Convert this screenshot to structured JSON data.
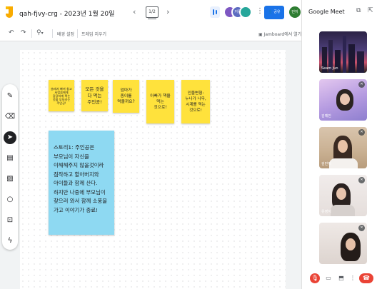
{
  "app": {
    "title": "qah-fjvy-crg - 2023년 1월 20일",
    "page_indicator": "1/2"
  },
  "header": {
    "prev_icon": "chevron-left-icon",
    "next_icon": "chevron-right-icon",
    "avatars": [
      {
        "initial": "",
        "color": "#7e57c2"
      },
      {
        "initial": "커뮤",
        "color": "#5c6bc0"
      },
      {
        "initial": "",
        "color": "#26a69a"
      }
    ],
    "share_label": "공유",
    "user_initial": "민지",
    "accent": "#1a73e8"
  },
  "toolbar": {
    "undo_icon": "undo-icon",
    "redo_icon": "redo-icon",
    "zoom_icon": "zoom-icon",
    "background_label": "배경 설정",
    "clear_frame_label": "프레임 지우기",
    "open_in_jamboard_label": "Jamboard에서 열기"
  },
  "tools": [
    "pen-icon",
    "eraser-icon",
    "select-icon",
    "sticky-note-icon",
    "image-icon",
    "circle-icon",
    "text-box-icon",
    "laser-icon"
  ],
  "notes": [
    {
      "text": "술래서 빠져 참고\n서럽움에게\n당당하게 짝는\n것을 부모라는\n주인공!",
      "size": 5
    },
    {
      "text": "모든 것을\n다 먹는\n주인공!",
      "size": 8
    },
    {
      "text": "엄마가\n종이를\n먹을까요?",
      "size": 7
    },
    {
      "text": "아빠가 책을\n먹는\n것으로!",
      "size": 7
    },
    {
      "text": "인물변형:\n누나가 나무,\n시계를 먹는\n것으로!",
      "size": 7
    }
  ],
  "story_note": {
    "text": "스토리1: 주인공은\n부모님이 자신을\n이해해주지 않을것이라\n짐작하고 할아버지와\n아이들과 함께 산다.\n하지만 나중에 부모님이\n찾으러 와서 함께 소풍을\n가고 이야기가 종료!"
  },
  "meet": {
    "title": "Google Meet",
    "tiles": [
      {
        "name": "Seam Jun"
      },
      {
        "name": "김예진"
      },
      {
        "name": "김민지"
      },
      {
        "name": "유영지"
      },
      {
        "name": ""
      }
    ],
    "controls": [
      "mic-off-icon",
      "camera-icon",
      "present-icon",
      "more-icon",
      "end-call-icon"
    ]
  }
}
